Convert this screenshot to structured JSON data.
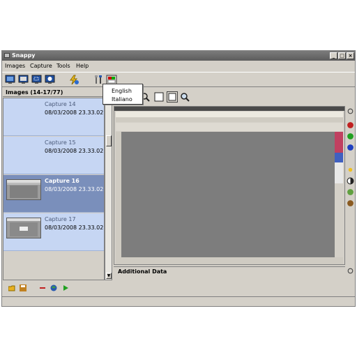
{
  "window": {
    "title": "Snappy"
  },
  "menu": [
    "Images",
    "Capture",
    "Tools",
    "Help"
  ],
  "toolbar_icons": [
    "monitor-capture-icon",
    "window-capture-icon",
    "region-capture-icon",
    "timed-capture-icon",
    "lightning-icon",
    "tools-icon",
    "language-flag-icon"
  ],
  "left_panel": {
    "header": "Images (14-17/77)",
    "items": [
      {
        "name": "Capture 14",
        "date": "08/03/2008 23.33.02",
        "has_thumb": false,
        "selected": false
      },
      {
        "name": "Capture 15",
        "date": "08/03/2008 23.33.02",
        "has_thumb": false,
        "selected": false
      },
      {
        "name": "Capture 16",
        "date": "08/03/2008 23.33.02",
        "has_thumb": true,
        "selected": true
      },
      {
        "name": "Capture 17",
        "date": "08/03/2008 23.33.02",
        "has_thumb": true,
        "selected": false
      }
    ],
    "bottom_icons": [
      "open-folder-icon",
      "save-icon",
      "delete-icon",
      "globe-icon",
      "play-icon"
    ]
  },
  "language_menu": {
    "items": [
      "English",
      "Italiano"
    ]
  },
  "right_panel": {
    "view_tools": [
      "pan-icon",
      "zoom-icon",
      "fit-icon",
      "actual-size-icon",
      "magnifier-icon"
    ],
    "additional_data_label": "Additional Data"
  },
  "colors": {
    "accent": "#7a8fbb",
    "list_bg": "#c6d6f3",
    "titlebar": "#6b6b6b",
    "canvas": "#7d7d7d"
  }
}
